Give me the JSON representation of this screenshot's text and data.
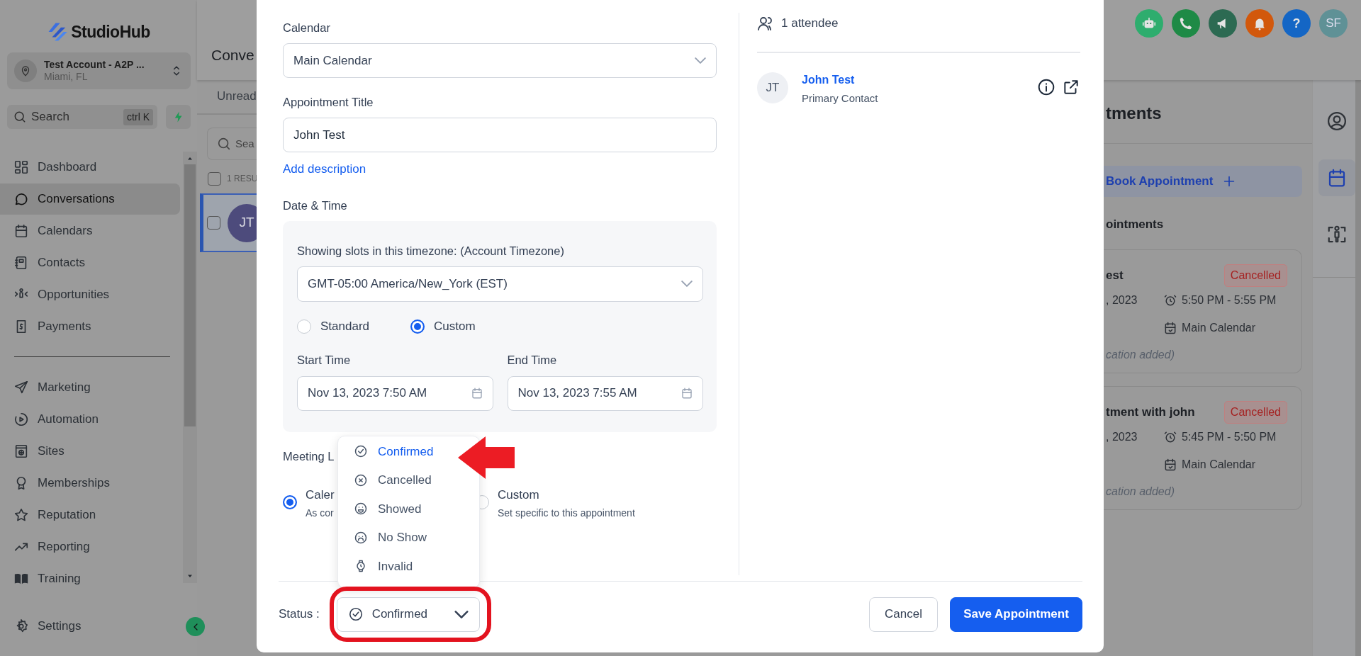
{
  "sidebar": {
    "brand": "StudioHub",
    "account": {
      "name": "Test Account - A2P ...",
      "location": "Miami, FL"
    },
    "search": {
      "placeholder": "Search",
      "shortcut": "ctrl K"
    },
    "nav_groups": [
      [
        {
          "label": "Dashboard",
          "selected": false
        },
        {
          "label": "Conversations",
          "selected": true
        },
        {
          "label": "Calendars",
          "selected": false
        },
        {
          "label": "Contacts",
          "selected": false
        },
        {
          "label": "Opportunities",
          "selected": false
        },
        {
          "label": "Payments",
          "selected": false
        }
      ],
      [
        {
          "label": "Marketing",
          "selected": false
        },
        {
          "label": "Automation",
          "selected": false
        },
        {
          "label": "Sites",
          "selected": false
        },
        {
          "label": "Memberships",
          "selected": false
        },
        {
          "label": "Reputation",
          "selected": false
        },
        {
          "label": "Reporting",
          "selected": false
        },
        {
          "label": "Training",
          "selected": false
        }
      ]
    ],
    "settings": "Settings"
  },
  "conversations": {
    "title": "Conve",
    "tab": "Unread",
    "search_placeholder": "Sea",
    "select_all": {
      "checked": false
    },
    "results": "1 RESU",
    "rows": [
      {
        "initials": "JT",
        "selected": true,
        "checked": false
      }
    ]
  },
  "header_actions": [
    {
      "kind": "icon",
      "color": "#2ead6e"
    },
    {
      "kind": "icon",
      "color": "#1e8a46"
    },
    {
      "kind": "icon",
      "color": "#2c6a52"
    },
    {
      "kind": "icon",
      "color": "#d2580c"
    },
    {
      "kind": "glyph",
      "label": "?",
      "color": "#1466c5"
    },
    {
      "kind": "avatar",
      "label": "SF",
      "color": "#5f9196"
    }
  ],
  "appointments": {
    "title": "tments",
    "book_button": "Book Appointment",
    "section": "ointments",
    "cards": [
      {
        "title": "est",
        "status": "Cancelled",
        "date": ", 2023",
        "time": "5:50 PM - 5:55 PM",
        "calendar": "Main Calendar",
        "location": "cation added)"
      },
      {
        "title": "tment with john",
        "status": "Cancelled",
        "date": ", 2023",
        "time": "5:45 PM - 5:50 PM",
        "calendar": "Main Calendar",
        "location": "cation added)"
      }
    ]
  },
  "side_tabs": [
    {
      "selected": false
    },
    {
      "selected": true
    },
    {
      "selected": false
    }
  ],
  "modal": {
    "calendar": {
      "label": "Calendar",
      "value": "Main Calendar"
    },
    "title_field": {
      "label": "Appointment Title",
      "value": "John Test"
    },
    "add_description": "Add description",
    "date_time": {
      "label": "Date & Time",
      "timezone_label": "Showing slots in this timezone: (Account Timezone)",
      "timezone": "GMT-05:00 America/New_York (EST)",
      "slot_modes": [
        {
          "label": "Standard",
          "selected": false
        },
        {
          "label": "Custom",
          "selected": true
        }
      ],
      "start": {
        "label": "Start Time",
        "value": "Nov 13, 2023 7:50 AM"
      },
      "end": {
        "label": "End Time",
        "value": "Nov 13, 2023 7:55 AM"
      }
    },
    "meeting_location": {
      "label": "Meeting L",
      "options": [
        {
          "title": "Caler",
          "subtitle": "As cor",
          "selected": true
        },
        {
          "title": "Custom",
          "subtitle": "Set specific to this appointment",
          "selected": false
        }
      ]
    },
    "status": {
      "label": "Status :",
      "value": "Confirmed",
      "expanded": true,
      "options": [
        {
          "label": "Confirmed",
          "selected": true
        },
        {
          "label": "Cancelled",
          "selected": false
        },
        {
          "label": "Showed",
          "selected": false
        },
        {
          "label": "No Show",
          "selected": false
        },
        {
          "label": "Invalid",
          "selected": false
        }
      ]
    },
    "buttons": [
      {
        "label": "Cancel",
        "kind": "secondary"
      },
      {
        "label": "Save Appointment",
        "kind": "primary"
      }
    ],
    "attendees": {
      "count": "1 attendee",
      "items": [
        {
          "initials": "JT",
          "name": "John Test",
          "role": "Primary Contact"
        }
      ]
    }
  }
}
